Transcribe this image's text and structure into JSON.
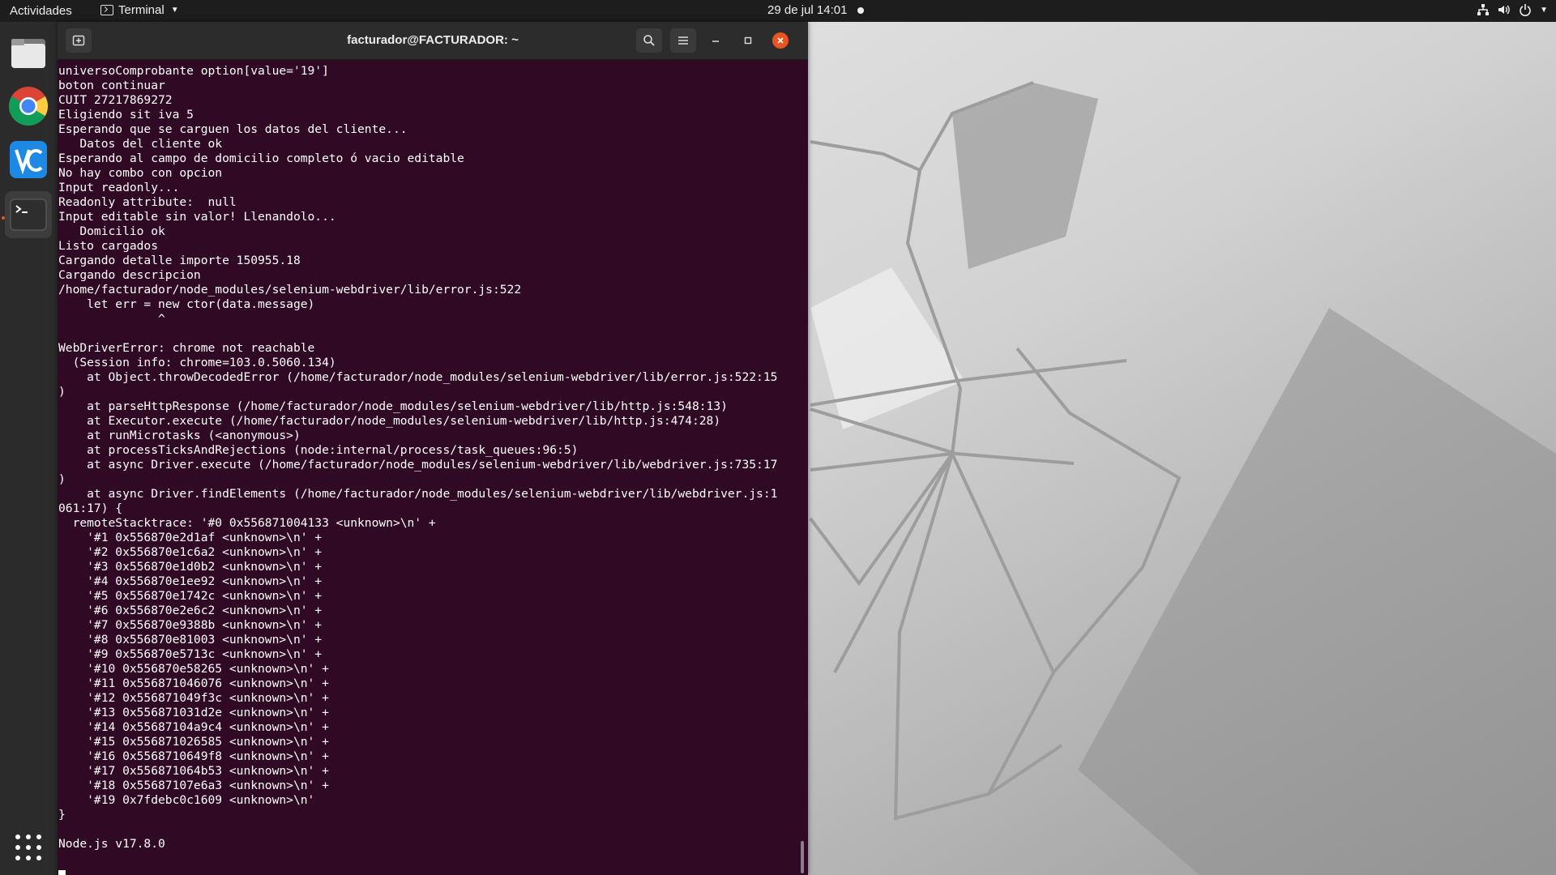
{
  "topbar": {
    "activities": "Actividades",
    "app_name": "Terminal",
    "clock": "29 de jul  14:01",
    "icons": [
      "network-icon",
      "volume-icon",
      "power-icon",
      "chevron-down-icon"
    ]
  },
  "dock": {
    "items": [
      {
        "name": "files",
        "icon": "files-icon"
      },
      {
        "name": "chrome",
        "icon": "chrome-icon"
      },
      {
        "name": "vnc",
        "icon": "vnc-icon"
      },
      {
        "name": "terminal",
        "icon": "terminal-icon",
        "active": true
      },
      {
        "name": "show-applications",
        "icon": "app-grid-icon"
      }
    ]
  },
  "colors": {
    "terminal_bg": "#300a24",
    "accent": "#e95420",
    "header_bg": "#2c2c2c"
  },
  "terminal": {
    "title": "facturador@FACTURADOR: ~",
    "lines": [
      "universoComprobante option[value='19']",
      "boton continuar",
      "CUIT 27217869272",
      "Eligiendo sit iva 5",
      "Esperando que se carguen los datos del cliente...",
      "   Datos del cliente ok",
      "Esperando al campo de domicilio completo ó vacio editable",
      "No hay combo con opcion",
      "Input readonly...",
      "Readonly attribute:  null",
      "Input editable sin valor! Llenandolo...",
      "   Domicilio ok",
      "Listo cargados",
      "Cargando detalle importe 150955.18",
      "Cargando descripcion",
      "/home/facturador/node_modules/selenium-webdriver/lib/error.js:522",
      "    let err = new ctor(data.message)",
      "              ^",
      "",
      "WebDriverError: chrome not reachable",
      "  (Session info: chrome=103.0.5060.134)",
      "    at Object.throwDecodedError (/home/facturador/node_modules/selenium-webdriver/lib/error.js:522:15",
      ")",
      "    at parseHttpResponse (/home/facturador/node_modules/selenium-webdriver/lib/http.js:548:13)",
      "    at Executor.execute (/home/facturador/node_modules/selenium-webdriver/lib/http.js:474:28)",
      "    at runMicrotasks (<anonymous>)",
      "    at processTicksAndRejections (node:internal/process/task_queues:96:5)",
      "    at async Driver.execute (/home/facturador/node_modules/selenium-webdriver/lib/webdriver.js:735:17",
      ")",
      "    at async Driver.findElements (/home/facturador/node_modules/selenium-webdriver/lib/webdriver.js:1",
      "061:17) {",
      "  remoteStacktrace: '#0 0x556871004133 <unknown>\\n' +",
      "    '#1 0x556870e2d1af <unknown>\\n' +",
      "    '#2 0x556870e1c6a2 <unknown>\\n' +",
      "    '#3 0x556870e1d0b2 <unknown>\\n' +",
      "    '#4 0x556870e1ee92 <unknown>\\n' +",
      "    '#5 0x556870e1742c <unknown>\\n' +",
      "    '#6 0x556870e2e6c2 <unknown>\\n' +",
      "    '#7 0x556870e9388b <unknown>\\n' +",
      "    '#8 0x556870e81003 <unknown>\\n' +",
      "    '#9 0x556870e5713c <unknown>\\n' +",
      "    '#10 0x556870e58265 <unknown>\\n' +",
      "    '#11 0x556871046076 <unknown>\\n' +",
      "    '#12 0x556871049f3c <unknown>\\n' +",
      "    '#13 0x556871031d2e <unknown>\\n' +",
      "    '#14 0x55687104a9c4 <unknown>\\n' +",
      "    '#15 0x556871026585 <unknown>\\n' +",
      "    '#16 0x5568710649f8 <unknown>\\n' +",
      "    '#17 0x556871064b53 <unknown>\\n' +",
      "    '#18 0x55687107e6a3 <unknown>\\n' +",
      "    '#19 0x7fdebc0c1609 <unknown>\\n'",
      "}",
      "",
      "Node.js v17.8.0"
    ]
  }
}
